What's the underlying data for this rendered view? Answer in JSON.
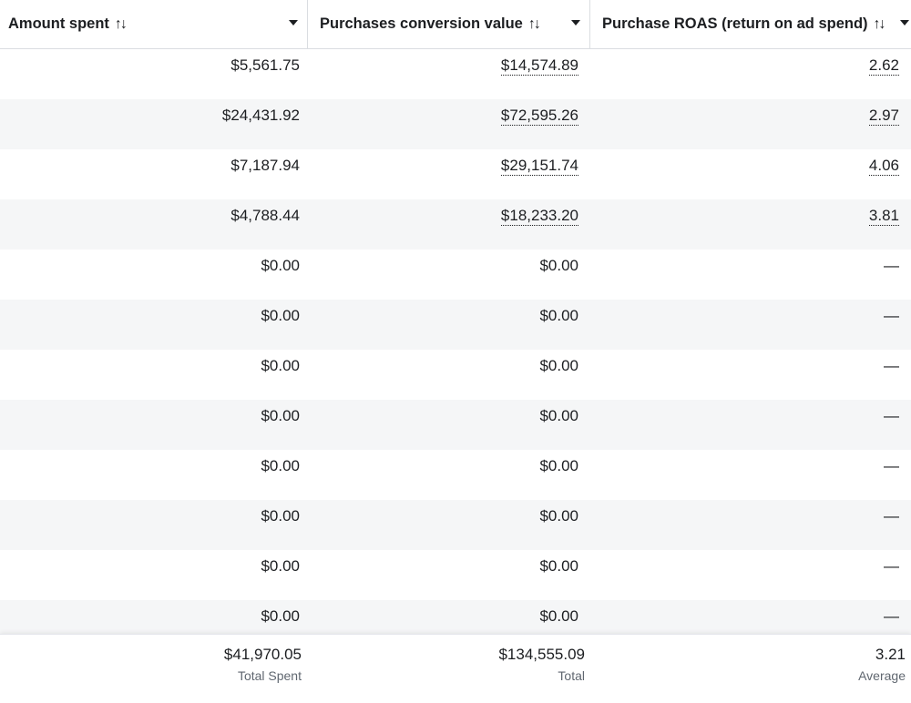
{
  "columns": [
    {
      "label": "Amount spent"
    },
    {
      "label": "Purchases conversion value"
    },
    {
      "label": "Purchase ROAS (return on ad spend)"
    }
  ],
  "sort_icon": "↑↓",
  "rows": [
    {
      "amount": "$5,561.75",
      "value": "$14,574.89",
      "roas": "2.62"
    },
    {
      "amount": "$24,431.92",
      "value": "$72,595.26",
      "roas": "2.97"
    },
    {
      "amount": "$7,187.94",
      "value": "$29,151.74",
      "roas": "4.06"
    },
    {
      "amount": "$4,788.44",
      "value": "$18,233.20",
      "roas": "3.81"
    },
    {
      "amount": "$0.00",
      "value": "$0.00",
      "roas": "—"
    },
    {
      "amount": "$0.00",
      "value": "$0.00",
      "roas": "—"
    },
    {
      "amount": "$0.00",
      "value": "$0.00",
      "roas": "—"
    },
    {
      "amount": "$0.00",
      "value": "$0.00",
      "roas": "—"
    },
    {
      "amount": "$0.00",
      "value": "$0.00",
      "roas": "—"
    },
    {
      "amount": "$0.00",
      "value": "$0.00",
      "roas": "—"
    },
    {
      "amount": "$0.00",
      "value": "$0.00",
      "roas": "—"
    },
    {
      "amount": "$0.00",
      "value": "$0.00",
      "roas": "—"
    }
  ],
  "footer": {
    "amount": {
      "value": "$41,970.05",
      "label": "Total Spent"
    },
    "value": {
      "value": "$134,555.09",
      "label": "Total"
    },
    "roas": {
      "value": "3.21",
      "label": "Average"
    }
  },
  "colors": {
    "alt_row": "#f5f6f7",
    "border": "#dadde1",
    "muted_text": "#606770"
  }
}
